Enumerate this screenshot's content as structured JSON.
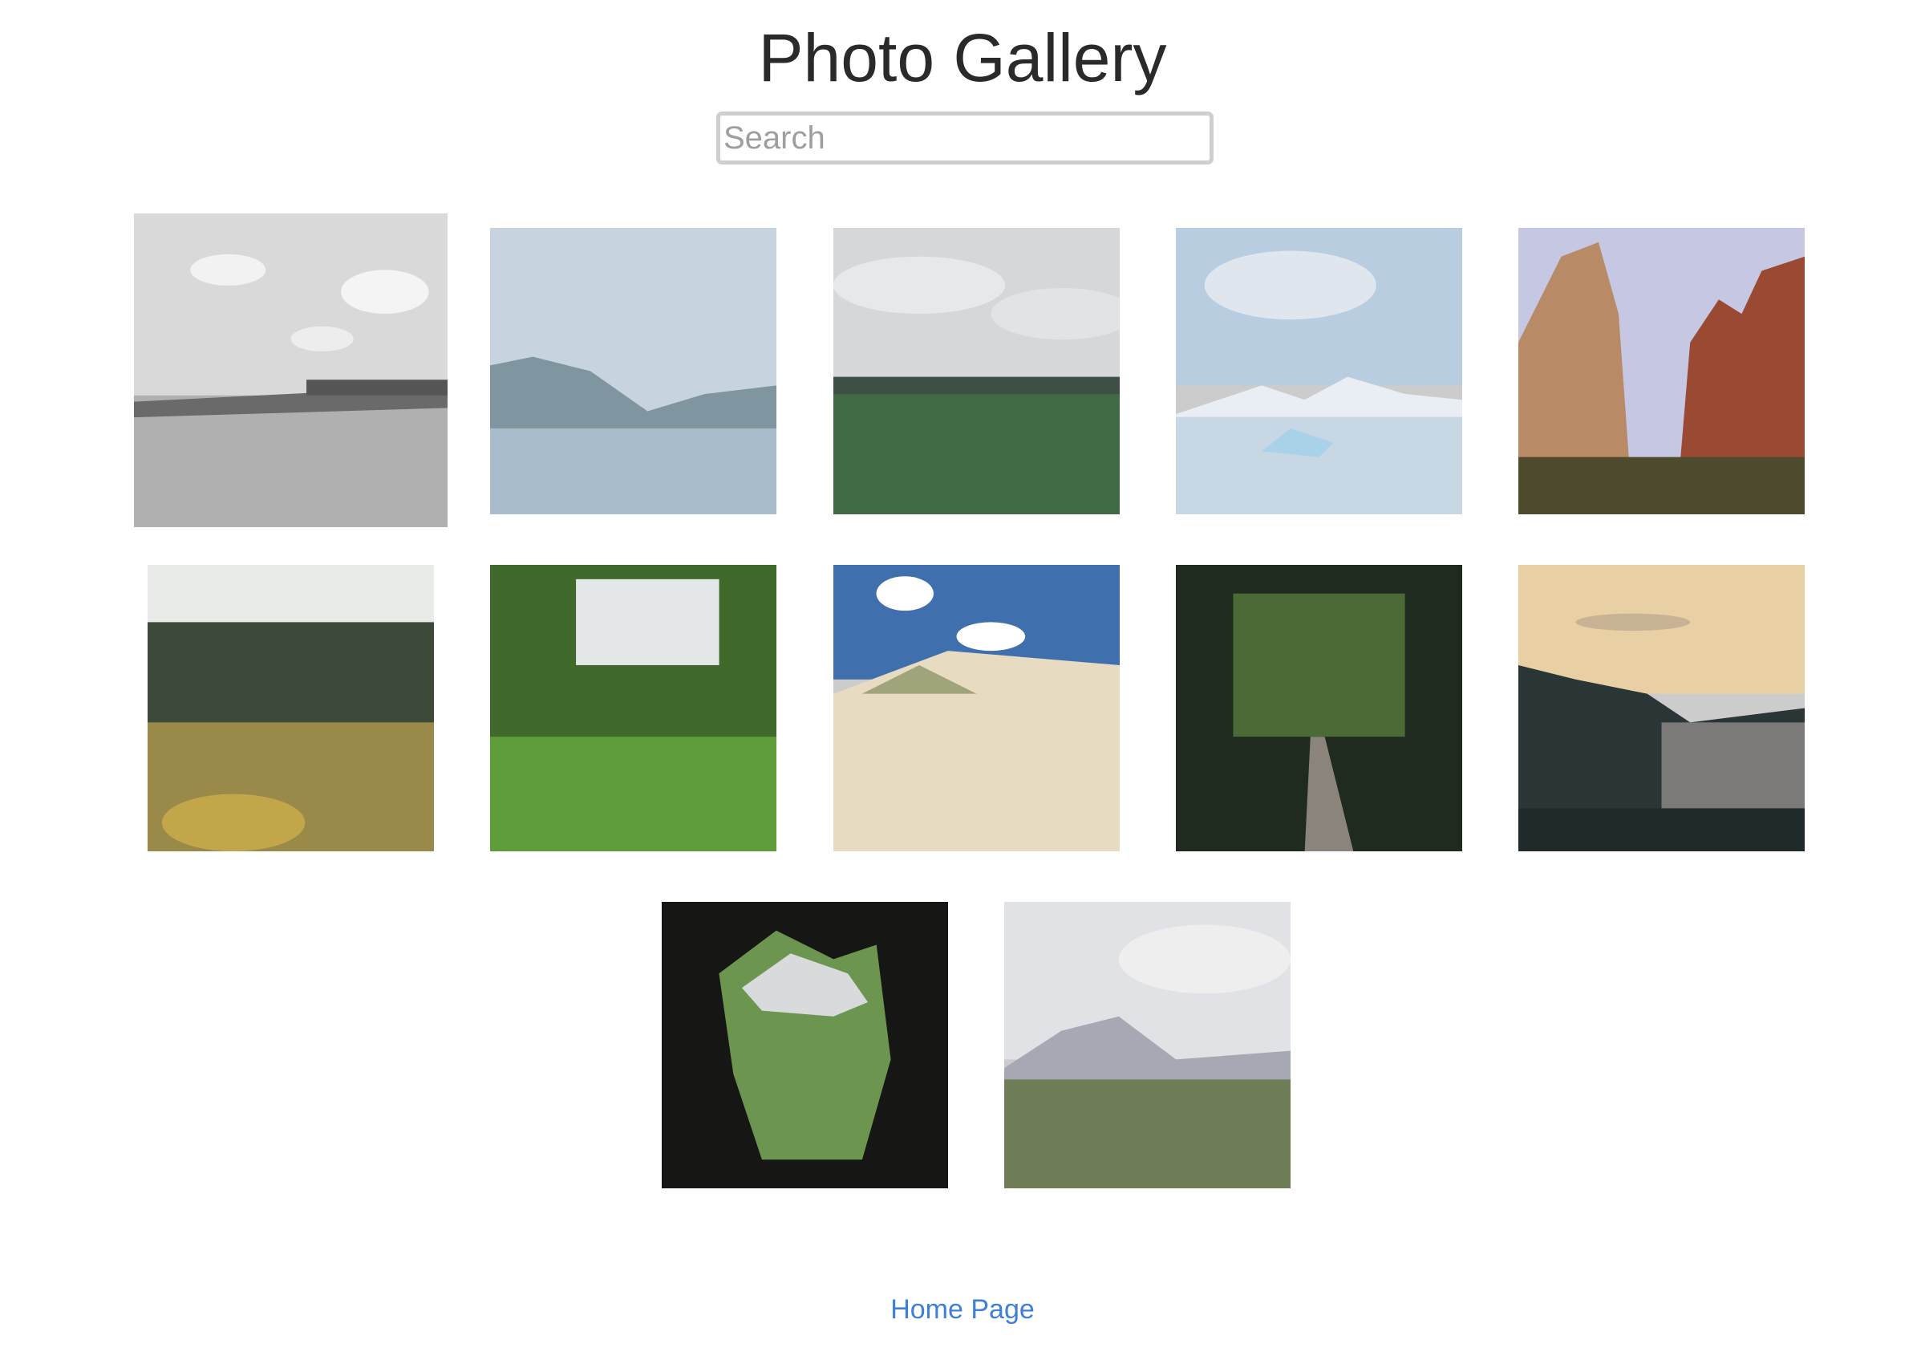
{
  "page": {
    "title": "Photo Gallery"
  },
  "search": {
    "placeholder": "Search",
    "value": ""
  },
  "gallery": {
    "photos": [
      {
        "name": "photo-grayscale-field"
      },
      {
        "name": "photo-mountain-lake"
      },
      {
        "name": "photo-green-meadow-cloudy"
      },
      {
        "name": "photo-glacier-lagoon"
      },
      {
        "name": "photo-red-rock-canyon"
      },
      {
        "name": "photo-garden-trees"
      },
      {
        "name": "photo-tropical-valley"
      },
      {
        "name": "photo-sand-dunes"
      },
      {
        "name": "photo-forest-path"
      },
      {
        "name": "photo-sunset-coast"
      },
      {
        "name": "photo-cave-view"
      },
      {
        "name": "photo-lupine-field-mountain"
      }
    ]
  },
  "footer": {
    "home_link": "Home Page"
  }
}
